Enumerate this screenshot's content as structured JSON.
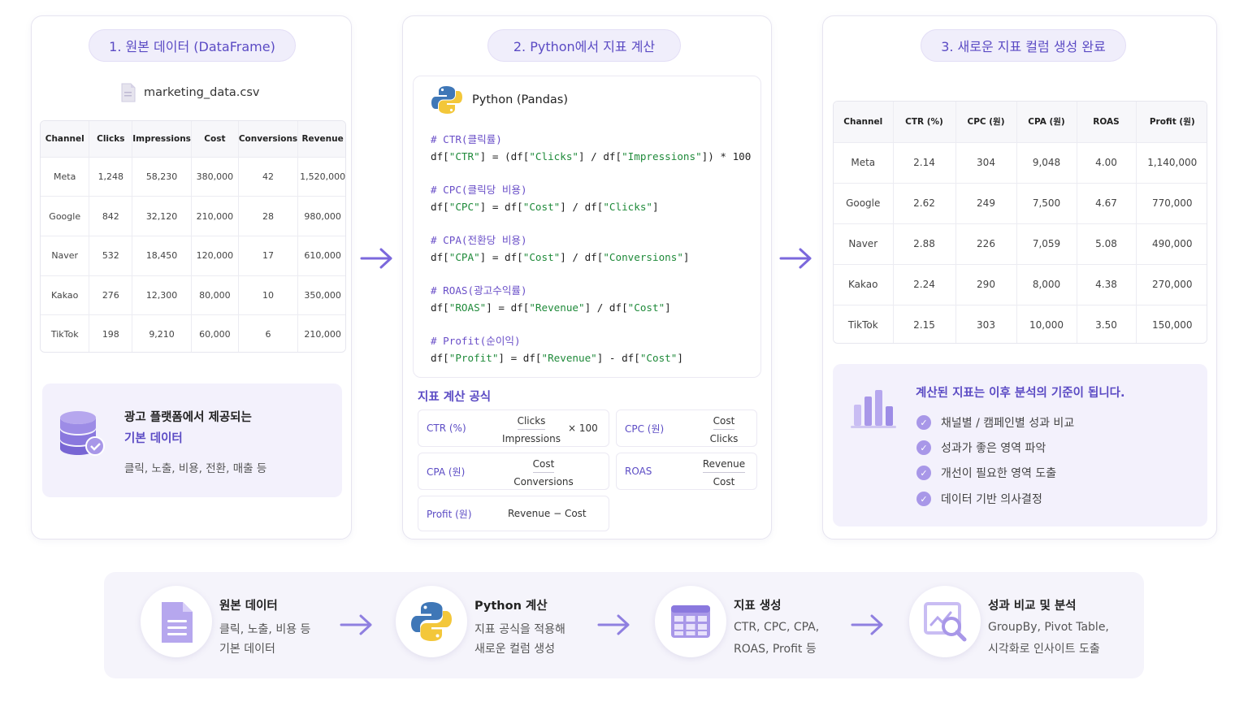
{
  "panel1": {
    "title": "1. 원본 데이터 (DataFrame)",
    "file_name": "marketing_data.csv",
    "table": {
      "headers": [
        "Channel",
        "Clicks",
        "Impressions",
        "Cost",
        "Conversions",
        "Revenue"
      ],
      "rows": [
        [
          "Meta",
          "1,248",
          "58,230",
          "380,000",
          "42",
          "1,520,000"
        ],
        [
          "Google",
          "842",
          "32,120",
          "210,000",
          "28",
          "980,000"
        ],
        [
          "Naver",
          "532",
          "18,450",
          "120,000",
          "17",
          "610,000"
        ],
        [
          "Kakao",
          "276",
          "12,300",
          "80,000",
          "10",
          "350,000"
        ],
        [
          "TikTok",
          "198",
          "9,210",
          "60,000",
          "6",
          "210,000"
        ]
      ]
    },
    "info": {
      "line1": "광고 플랫폼에서 제공되는",
      "line2": "기본 데이터",
      "line3": "클릭, 노출, 비용, 전환, 매출 등"
    }
  },
  "panel2": {
    "title": "2. Python에서 지표 계산",
    "code_title": "Python (Pandas)",
    "code": {
      "c1": "# CTR(클릭률)",
      "c2": "# CPC(클릭당 비용)",
      "c3": "# CPA(전환당 비용)",
      "c4": "# ROAS(광고수익률)",
      "c5": "# Profit(순이익)"
    },
    "formula_title": "지표 계산 공식",
    "formulas": {
      "ctr": {
        "label": "CTR (%)",
        "num": "Clicks",
        "den": "Impressions",
        "tail": "× 100"
      },
      "cpc": {
        "label": "CPC (원)",
        "num": "Cost",
        "den": "Clicks"
      },
      "cpa": {
        "label": "CPA (원)",
        "num": "Cost",
        "den": "Conversions"
      },
      "roas": {
        "label": "ROAS",
        "num": "Revenue",
        "den": "Cost"
      },
      "profit": {
        "label": "Profit (원)",
        "expr": "Revenue − Cost"
      }
    }
  },
  "panel3": {
    "title": "3. 새로운 지표 컬럼 생성 완료",
    "table": {
      "headers": [
        "Channel",
        "CTR (%)",
        "CPC (원)",
        "CPA (원)",
        "ROAS",
        "Profit (원)"
      ],
      "rows": [
        [
          "Meta",
          "2.14",
          "304",
          "9,048",
          "4.00",
          "1,140,000"
        ],
        [
          "Google",
          "2.62",
          "249",
          "7,500",
          "4.67",
          "770,000"
        ],
        [
          "Naver",
          "2.88",
          "226",
          "7,059",
          "5.08",
          "490,000"
        ],
        [
          "Kakao",
          "2.24",
          "290",
          "8,000",
          "4.38",
          "270,000"
        ],
        [
          "TikTok",
          "2.15",
          "303",
          "10,000",
          "3.50",
          "150,000"
        ]
      ]
    },
    "info": {
      "title": "계산된 지표는 이후 분석의 기준이 됩니다.",
      "items": [
        "채널별 / 캠페인별 성과 비교",
        "성과가 좋은 영역 파악",
        "개선이 필요한 영역 도출",
        "데이터 기반 의사결정"
      ]
    }
  },
  "flow": {
    "steps": [
      {
        "title": "원본 데이터",
        "line1": "클릭, 노출, 비용 등",
        "line2": "기본 데이터"
      },
      {
        "title": "Python 계산",
        "line1": "지표 공식을 적용해",
        "line2": "새로운 컬럼 생성"
      },
      {
        "title": "지표 생성",
        "line1": "CTR, CPC, CPA,",
        "line2": "ROAS, Profit 등"
      },
      {
        "title": "성과 비교 및 분석",
        "line1": "GroupBy, Pivot Table,",
        "line2": "시각화로 인사이트  도출"
      }
    ]
  },
  "colors": {
    "accent": "#5b4bc4",
    "accent_light": "#a897e8",
    "panel_bg": "#f3f1fc",
    "code_green": "#1f8a3a"
  }
}
